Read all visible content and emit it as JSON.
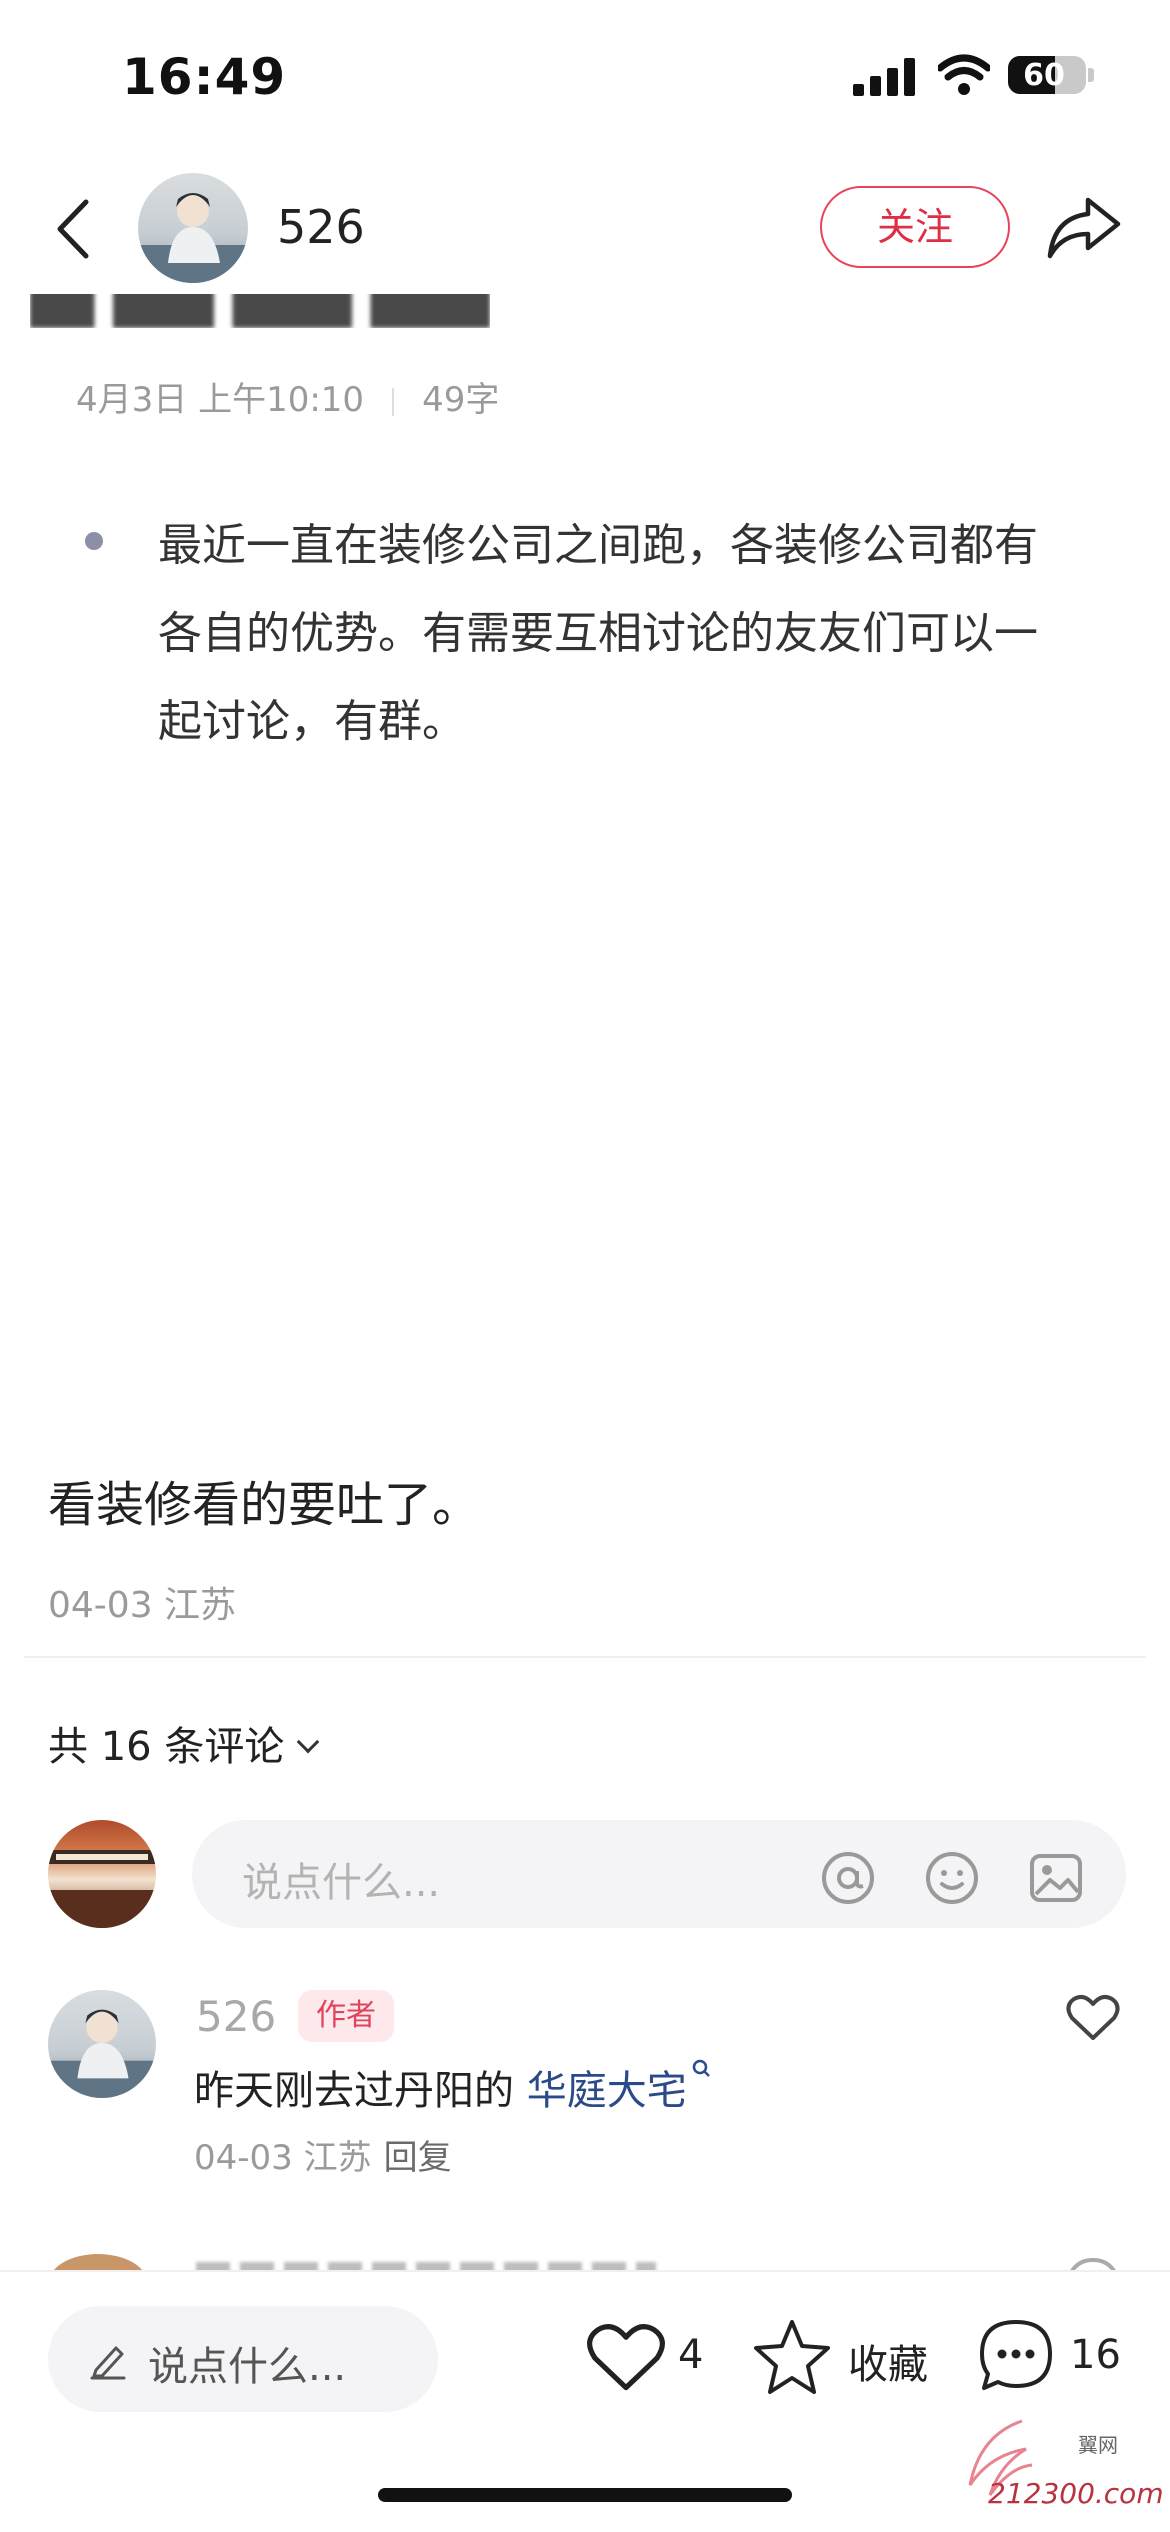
{
  "status_bar": {
    "time": "16:49",
    "battery": "60",
    "battery_level": 0.6
  },
  "nav": {
    "username": "526",
    "follow_label": "关注"
  },
  "post": {
    "meta_date": "4月3日 上午10:10",
    "meta_words": "49字",
    "paragraph": "最近一直在装修公司之间跑，各装修公司都有各自的优势。有需要互相讨论的友友们可以一起讨论，有群。",
    "caption": "看装修看的要吐了。",
    "date_location": "04-03 江苏"
  },
  "comments": {
    "count_label": "共 16 条评论",
    "input_placeholder": "说点什么...",
    "items": [
      {
        "user": "526",
        "tag": "作者",
        "text_prefix": "昨天刚去过丹阳的 ",
        "text_link": "华庭大宅",
        "meta": "04-03 江苏",
        "reply_label": "回复"
      }
    ]
  },
  "bottom_bar": {
    "input_placeholder": "说点什么...",
    "likes": "4",
    "collect_label": "收藏",
    "comments": "16"
  },
  "watermark": {
    "text": "212300.com",
    "sub": "翼网"
  }
}
